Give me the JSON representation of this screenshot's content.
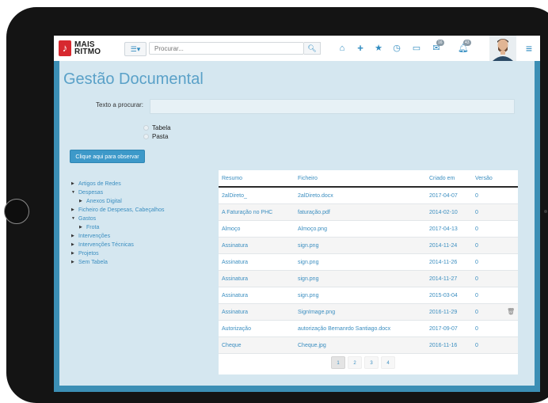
{
  "topbar": {
    "logo_line1": "MAIS",
    "logo_line2": "RITMO",
    "search_placeholder": "Procurar...",
    "icons": [
      "home-icon",
      "plus-icon",
      "star-icon",
      "clock-icon",
      "calendar-icon",
      "mail-icon",
      "bell-icon"
    ],
    "mail_badge": "16",
    "bell_badge": "43"
  },
  "page": {
    "title": "Gestão Documental",
    "search_label": "Texto a procurar:",
    "radio_tabela": "Tabela",
    "radio_pasta": "Pasta",
    "observe_button": "Clique aqui para observar"
  },
  "tree": [
    {
      "label": "Artigos de Redes",
      "expanded": false,
      "level": 0
    },
    {
      "label": "Despesas",
      "expanded": true,
      "level": 0
    },
    {
      "label": "Anexos Digital",
      "expanded": false,
      "level": 1
    },
    {
      "label": "Ficheiro de Despesas, Cabeçalhos",
      "expanded": false,
      "level": 0
    },
    {
      "label": "Gastos",
      "expanded": true,
      "level": 0
    },
    {
      "label": "Frota",
      "expanded": false,
      "level": 1
    },
    {
      "label": "Intervenções",
      "expanded": false,
      "level": 0
    },
    {
      "label": "Intervenções Técnicas",
      "expanded": false,
      "level": 0
    },
    {
      "label": "Projetos",
      "expanded": false,
      "level": 0
    },
    {
      "label": "Sem Tabela",
      "expanded": false,
      "level": 0
    }
  ],
  "table": {
    "headers": [
      "Resumo",
      "Ficheiro",
      "Criado em",
      "Versão"
    ],
    "rows": [
      {
        "resumo": "2alDireto_",
        "ficheiro": "2alDireto.docx",
        "data": "2017-04-07",
        "versao": "0"
      },
      {
        "resumo": "A Faturação no PHC",
        "ficheiro": "faturação.pdf",
        "data": "2014-02-10",
        "versao": "0"
      },
      {
        "resumo": "Almoço",
        "ficheiro": "Almoço.png",
        "data": "2017-04-13",
        "versao": "0"
      },
      {
        "resumo": "Assinatura",
        "ficheiro": "sign.png",
        "data": "2014-11-24",
        "versao": "0"
      },
      {
        "resumo": "Assinatura",
        "ficheiro": "sign.png",
        "data": "2014-11-26",
        "versao": "0"
      },
      {
        "resumo": "Assinatura",
        "ficheiro": "sign.png",
        "data": "2014-11-27",
        "versao": "0"
      },
      {
        "resumo": "Assinatura",
        "ficheiro": "sign.png",
        "data": "2015-03-04",
        "versao": "0"
      },
      {
        "resumo": "Assinatura",
        "ficheiro": "SignImage.png",
        "data": "2016-11-29",
        "versao": "0"
      },
      {
        "resumo": "Autorização",
        "ficheiro": "autorização Bernanrdo Santiago.docx",
        "data": "2017-09-07",
        "versao": "0"
      },
      {
        "resumo": "Cheque",
        "ficheiro": "Cheque.jpg",
        "data": "2016-11-16",
        "versao": "0"
      }
    ],
    "pages": [
      "1",
      "2",
      "3",
      "4"
    ],
    "active_page": "1"
  },
  "colors": {
    "accent": "#3b8ec0",
    "frame": "#3c8fb5",
    "content_bg": "#d5e7f0",
    "logo_red": "#d7282f"
  }
}
